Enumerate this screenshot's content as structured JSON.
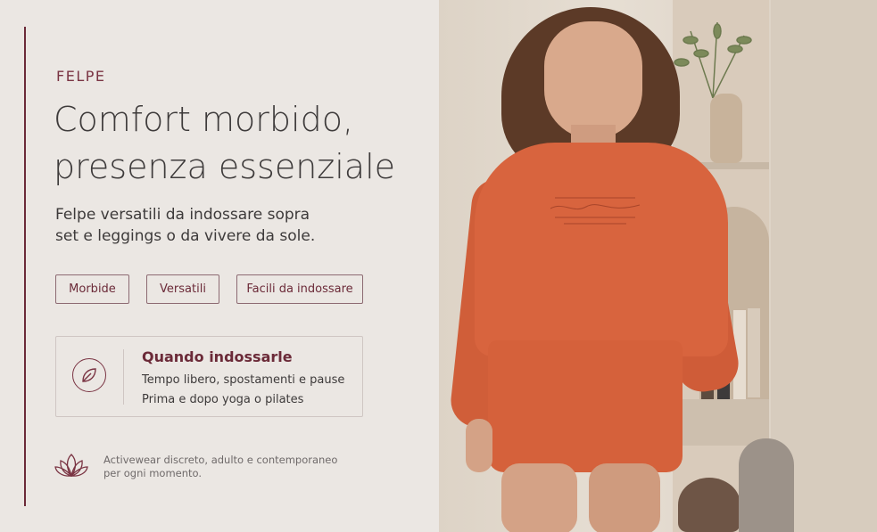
{
  "header": {
    "eyebrow": "FELPE",
    "title_line1": "Comfort morbido,",
    "title_line2": "presenza essenziale",
    "subtitle_line1": "Felpe versatili da indossare sopra",
    "subtitle_line2": "set e leggings o da vivere da sole."
  },
  "chips": [
    "Morbide",
    "Versatili",
    "Facili da indossare"
  ],
  "card": {
    "icon": "leaf-icon",
    "title": "Quando indossarle",
    "line1": "Tempo libero, spostamenti e pause",
    "line2": "Prima e dopo yoga o pilates"
  },
  "footer": {
    "icon": "lotus-icon",
    "line1": "Activewear discreto, adulto e contemporaneo",
    "line2": "per ogni momento."
  },
  "colors": {
    "accent": "#6b2a38",
    "background": "#ebe7e3",
    "garment": "#d8643e"
  }
}
